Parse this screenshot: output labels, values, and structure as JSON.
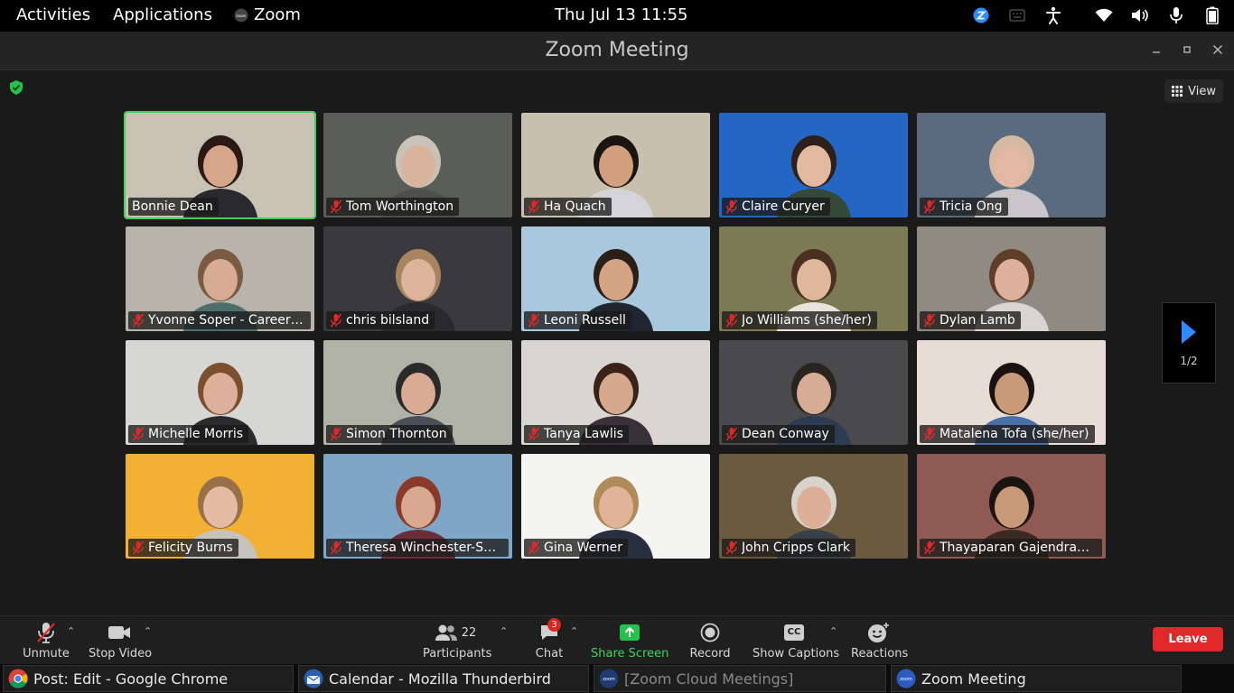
{
  "topbar": {
    "activities": "Activities",
    "applications": "Applications",
    "app_name": "Zoom",
    "clock": "Thu Jul 13  11:55"
  },
  "window": {
    "title": "Zoom Meeting",
    "view_label": "View"
  },
  "participants": [
    {
      "name": "Bonnie Dean",
      "bg": "#c9c1b3",
      "shirt": "#2a2a2e",
      "skin": "#d7a58a",
      "hair": "#2a1a14",
      "active": true,
      "muted": false
    },
    {
      "name": "Tom Worthington",
      "bg": "#5b5e58",
      "shirt": "#4f5149",
      "skin": "#d9b39c",
      "hair": "#c8c2b8",
      "active": false,
      "muted": true
    },
    {
      "name": "Ha Quach",
      "bg": "#c9bfae",
      "shirt": "#d4d4d8",
      "skin": "#d2a07f",
      "hair": "#1b1410",
      "active": false,
      "muted": true
    },
    {
      "name": "Claire Curyer",
      "bg": "#2366c4",
      "shirt": "#35493b",
      "skin": "#e0b9a0",
      "hair": "#2e2018",
      "active": false,
      "muted": true
    },
    {
      "name": "Tricia Ong",
      "bg": "#5a6b80",
      "shirt": "#c8c6c8",
      "skin": "#e2b8a2",
      "hair": "#d4b9a3",
      "active": false,
      "muted": true
    },
    {
      "name": "Yvonne Soper - Careers...",
      "bg": "#b8b4ac",
      "shirt": "#4d6f6a",
      "skin": "#d8ac92",
      "hair": "#7a5a40",
      "active": false,
      "muted": true
    },
    {
      "name": "chris bilsland",
      "bg": "#3a3a3e",
      "shirt": "#2a2a2e",
      "skin": "#dcb49c",
      "hair": "#a88560",
      "active": false,
      "muted": true
    },
    {
      "name": "Leoni Russell",
      "bg": "#a9c7dd",
      "shirt": "#1f2630",
      "skin": "#d4a384",
      "hair": "#2a2018",
      "active": false,
      "muted": true
    },
    {
      "name": "Jo Williams (she/her)",
      "bg": "#7c7a52",
      "shirt": "#e8e4dc",
      "skin": "#e0b89c",
      "hair": "#4a3020",
      "active": false,
      "muted": true
    },
    {
      "name": "Dylan Lamb",
      "bg": "#8f8a82",
      "shirt": "#d8d6d2",
      "skin": "#dcb09a",
      "hair": "#5e3e28",
      "active": false,
      "muted": true
    },
    {
      "name": "Michelle Morris",
      "bg": "#d6d6d4",
      "shirt": "#2b2a2c",
      "skin": "#dcb09a",
      "hair": "#7a5030",
      "active": false,
      "muted": true
    },
    {
      "name": "Simon Thornton",
      "bg": "#b0b2a8",
      "shirt": "#4a4e56",
      "skin": "#d9ab92",
      "hair": "#2a2a2a",
      "active": false,
      "muted": true
    },
    {
      "name": "Tanya Lawlis",
      "bg": "#d8d6d0",
      "shirt": "#3a3038",
      "skin": "#d6a88e",
      "hair": "#3a2218",
      "active": false,
      "muted": true
    },
    {
      "name": "Dean Conway",
      "bg": "#4a4a4c",
      "shirt": "#2e3c52",
      "skin": "#d6ac94",
      "hair": "#2a2420",
      "active": false,
      "muted": true
    },
    {
      "name": "Matalena Tofa (she/her)",
      "bg": "#e8dcd6",
      "shirt": "#4a6ea6",
      "skin": "#c99a78",
      "hair": "#1a1210",
      "active": false,
      "muted": true
    },
    {
      "name": "Felicity Burns",
      "bg": "#f2b132",
      "shirt": "#c6c2bc",
      "skin": "#e4bca4",
      "hair": "#9a7048",
      "active": false,
      "muted": true
    },
    {
      "name": "Theresa Winchester-Se...",
      "bg": "#7fa6c6",
      "shirt": "#6a2e3a",
      "skin": "#d8a890",
      "hair": "#8a3a28",
      "active": false,
      "muted": true
    },
    {
      "name": "Gina Werner",
      "bg": "#f4f4f2",
      "shirt": "#283040",
      "skin": "#e0b498",
      "hair": "#b08a58",
      "active": false,
      "muted": true
    },
    {
      "name": "John Cripps Clark",
      "bg": "#6a5a40",
      "shirt": "#3a4048",
      "skin": "#dcae96",
      "hair": "#d8d4cc",
      "active": false,
      "muted": true
    },
    {
      "name": "Thayaparan Gajendran ...",
      "bg": "#8e5a52",
      "shirt": "#3a2a22",
      "skin": "#c99a7a",
      "hair": "#1a1412",
      "active": false,
      "muted": true
    }
  ],
  "pagination": {
    "label": "1/2"
  },
  "toolbar": {
    "unmute": "Unmute",
    "stop_video": "Stop Video",
    "participants_count": "22",
    "participants": "Participants",
    "chat_badge": "3",
    "chat": "Chat",
    "share_screen": "Share Screen",
    "record": "Record",
    "show_captions": "Show Captions",
    "captions_icon_text": "CC",
    "reactions": "Reactions",
    "leave": "Leave"
  },
  "taskbar": [
    {
      "label": "Post: Edit - Google Chrome",
      "icon": "chrome-icon"
    },
    {
      "label": "Calendar - Mozilla Thunderbird",
      "icon": "thunderbird-icon"
    },
    {
      "label": "[Zoom Cloud Meetings]",
      "icon": "zoom-icon"
    },
    {
      "label": "Zoom Meeting",
      "icon": "zoom-icon"
    }
  ],
  "colors": {
    "active_speaker": "#3ed35a",
    "share_green": "#24c24d",
    "leave_red": "#e02828",
    "zoom_blue": "#2d8cff"
  }
}
